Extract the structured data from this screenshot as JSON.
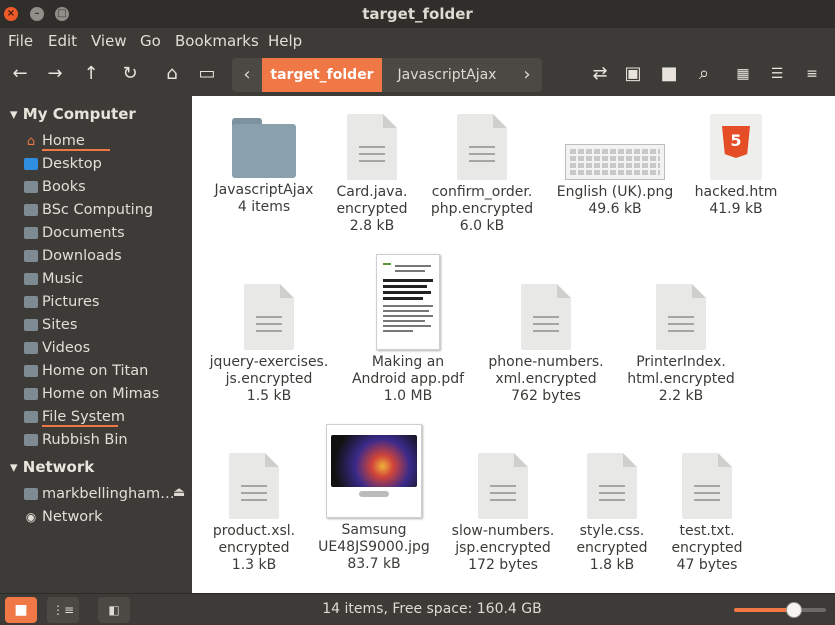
{
  "window": {
    "title": "target_folder"
  },
  "menu": [
    "File",
    "Edit",
    "View",
    "Go",
    "Bookmarks",
    "Help"
  ],
  "path": {
    "active": "target_folder",
    "next": "JavascriptAjax"
  },
  "sidebar": {
    "my_computer": "My Computer",
    "places": [
      {
        "label": "Home",
        "icon": "home-icon"
      },
      {
        "label": "Desktop",
        "icon": "desktop-icon"
      },
      {
        "label": "Books",
        "icon": "folder-icon"
      },
      {
        "label": "BSc Computing",
        "icon": "folder-icon"
      },
      {
        "label": "Documents",
        "icon": "folder-icon"
      },
      {
        "label": "Downloads",
        "icon": "folder-icon"
      },
      {
        "label": "Music",
        "icon": "folder-icon"
      },
      {
        "label": "Pictures",
        "icon": "folder-icon"
      },
      {
        "label": "Sites",
        "icon": "folder-icon"
      },
      {
        "label": "Videos",
        "icon": "folder-icon"
      },
      {
        "label": "Home on Titan",
        "icon": "network-folder-icon"
      },
      {
        "label": "Home on Mimas",
        "icon": "network-folder-icon"
      },
      {
        "label": "File System",
        "icon": "drive-icon"
      },
      {
        "label": "Rubbish Bin",
        "icon": "trash-icon"
      }
    ],
    "network": "Network",
    "network_items": [
      {
        "label": "markbellingham…",
        "icon": "drive-icon"
      },
      {
        "label": "Network",
        "icon": "globe-icon"
      }
    ]
  },
  "files": [
    {
      "name": "JavascriptAjax",
      "meta": "4 items",
      "kind": "folder"
    },
    {
      "name": "Card.java.\nencrypted",
      "meta": "2.8 kB",
      "kind": "doc"
    },
    {
      "name": "confirm_order.\nphp.encrypted",
      "meta": "6.0 kB",
      "kind": "doc"
    },
    {
      "name": "English (UK).png",
      "meta": "49.6 kB",
      "kind": "keyboard"
    },
    {
      "name": "hacked.htm",
      "meta": "41.9 kB",
      "kind": "html"
    },
    {
      "name": "jquery-exercises.\njs.encrypted",
      "meta": "1.5 kB",
      "kind": "doc"
    },
    {
      "name": "Making an\nAndroid app.pdf",
      "meta": "1.0 MB",
      "kind": "pdf"
    },
    {
      "name": "phone-numbers.\nxml.encrypted",
      "meta": "762 bytes",
      "kind": "doc"
    },
    {
      "name": "PrinterIndex.\nhtml.encrypted",
      "meta": "2.2 kB",
      "kind": "doc"
    },
    {
      "name": "product.xsl.\nencrypted",
      "meta": "1.3 kB",
      "kind": "doc"
    },
    {
      "name": "Samsung\nUE48JS9000.jpg",
      "meta": "83.7 kB",
      "kind": "tv"
    },
    {
      "name": "slow-numbers.\njsp.encrypted",
      "meta": "172 bytes",
      "kind": "doc"
    },
    {
      "name": "style.css.\nencrypted",
      "meta": "1.8 kB",
      "kind": "doc"
    },
    {
      "name": "test.txt.\nencrypted",
      "meta": "47 bytes",
      "kind": "doc"
    }
  ],
  "status": {
    "text": "14 items, Free space: 160.4 GB",
    "zoom_level": 0.65
  },
  "colors": {
    "accent": "#f07746",
    "sidebar_bg": "#3c3b37",
    "content_bg": "#ffffff"
  }
}
